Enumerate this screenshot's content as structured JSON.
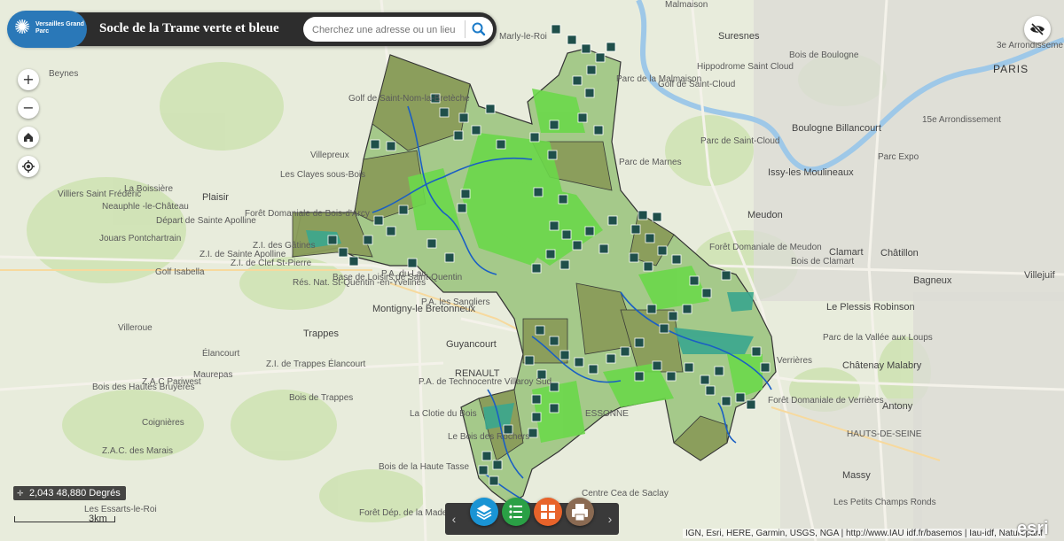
{
  "header": {
    "logo_text": "Versailles Grand Parc",
    "title": "Socle de la Trame verte et bleue",
    "search_placeholder": "Cherchez une adresse ou un lieu"
  },
  "controls": {
    "zoom_in": "+",
    "zoom_out": "−"
  },
  "status": {
    "coordinates": "2,043 48,880 Degrés",
    "scale": "3km"
  },
  "attribution": "IGN, Esri, HERE, Garmin, USGS, NGA | http://www.IAU idf.fr/basemos | Iau-idf, Natureparif",
  "esri_logo": "esri",
  "map_labels": {
    "malmaison": "Malmaison",
    "suresnes": "Suresnes",
    "marly": "Marly-le-Roi",
    "beynes": "Beynes",
    "golf_nom": "Golf de Saint-Nom-la-Bretèche",
    "golf_stcloud": "Golf de Saint-Cloud",
    "hippodrome": "Hippodrome Saint Cloud",
    "parc_stcloud": "Parc de Saint-Cloud",
    "parc_malmaison": "Parc de la Malmaison",
    "parc_marnes": "Parc de Marnes",
    "bois_boulogne": "Bois de Boulogne",
    "boulogne": "Boulogne Billancourt",
    "issy": "Issy-les Moulineaux",
    "paris": "PARIS",
    "arr3": "3e Arrondisseme",
    "arr15": "15e Arrondissement",
    "parc_expo": "Parc Expo",
    "villepreux": "Villepreux",
    "clayes": "Les Clayes sous-Bois",
    "boissiere": "La Boissière",
    "plaisir": "Plaisir",
    "villiers": "Villiers Saint Frédéric",
    "neauphle": "Neauphle -le-Château",
    "foret_bois_arcy": "Forêt Domaniale de Bois-d'Arcy",
    "jouars": "Jouars Pontchartrain",
    "depart_apolline": "Départ de Sainte Apolline",
    "zi_gatines": "Z.I. des Gâtines",
    "zi_stpierre": "Z.I. de Clef St-Pierre",
    "zi_apolline": "Z.I. de Sainte Apolline",
    "golf_isabella": "Golf Isabella",
    "res_stquentin": "Rés. Nat. St-Quentin -en-Yvelines",
    "base_loisirs": "Base de Loisirs de Saint-Quentin",
    "parc_lac": "P.A. du Lac",
    "pa_sanglier": "P.A. les Sangliers",
    "montigny": "Montigny-le Bretonneux",
    "trappes": "Trappes",
    "villeroue": "Villeroue",
    "elancourt": "Élancourt",
    "zl_trappes": "Z.I. de Trappes Élancourt",
    "maurepas": "Maurepas",
    "zac_pariwest": "Z.A.C Pariwest",
    "bois_bruyeres": "Bois des Hautes Bruyères",
    "coignieres": "Coignières",
    "guyancourt": "Guyancourt",
    "renault": "RENAULT",
    "pa_techno": "P.A. de Technocentre Villaroy Sud",
    "bois_trappes": "Bois de Trappes",
    "la_clotie": "La Clotie du Bois",
    "bois_rochers": "Le Bois des Rochers",
    "bois_haute": "Bois de la Haute Tasse",
    "zac_marais": "Z.A.C. des Marais",
    "essarts": "Les Essarts-le-Roi",
    "foret_madeleine": "Forêt Dép. de la Madeleine",
    "meudon": "Meudon",
    "clamart": "Clamart",
    "chatillon": "Châtillon",
    "foret_meudon": "Forêt Domaniale de Meudon",
    "bois_clamart": "Bois de Clamart",
    "bagneux": "Bagneux",
    "villejuif": "Villejuif",
    "plessis": "Le Plessis Robinson",
    "parc_aulnay": "Parc de la Vallée aux Loups",
    "chatenay": "Châtenay Malabry",
    "verrieres": "Verrières",
    "foret_verrieres": "Forêt Domaniale de Verrières",
    "antony": "Antony",
    "massy": "Massy",
    "hauts_seine": "HAUTS-DE-SEINE",
    "essonne": "ESSONNE",
    "centre_saclay": "Centre Cea de Saclay",
    "champs_ronds": "Les Petits Champs Ronds"
  },
  "toolbar": {
    "prev_arrow": "‹",
    "next_arrow": "›",
    "buttons": [
      {
        "name": "layers",
        "color": "#1a94d4"
      },
      {
        "name": "legend",
        "color": "#2aa045"
      },
      {
        "name": "basemap",
        "color": "#e8632a"
      },
      {
        "name": "print",
        "color": "#8a6a52"
      }
    ]
  }
}
